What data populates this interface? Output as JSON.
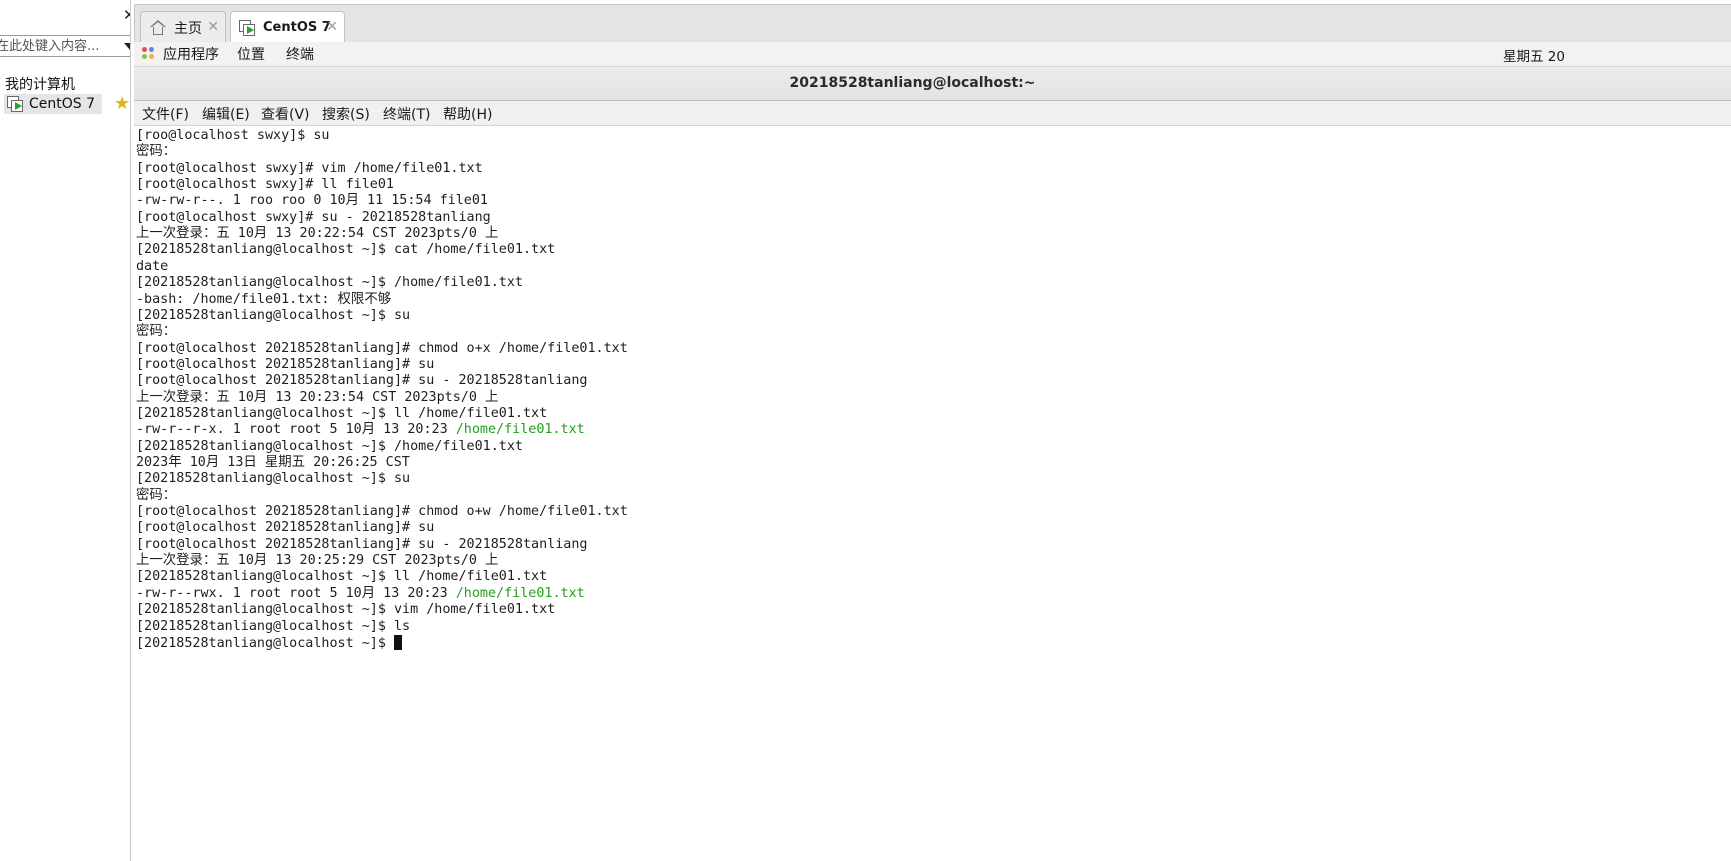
{
  "sidebar": {
    "search_placeholder": "在此处键入内容...",
    "tree_root": "我的计算机",
    "tree_item": "CentOS 7"
  },
  "tabs": [
    {
      "label": "主页",
      "icon": "home-icon"
    },
    {
      "label": "CentOS 7",
      "icon": "vm-icon"
    }
  ],
  "gnome_bar": {
    "applications": "应用程序",
    "places": "位置",
    "terminal": "终端",
    "clock": "星期五 20"
  },
  "window": {
    "title": "20218528tanliang@localhost:~"
  },
  "menubar": [
    "文件(F)",
    "编辑(E)",
    "查看(V)",
    "搜索(S)",
    "终端(T)",
    "帮助(H)"
  ],
  "colors": {
    "accent_green": "#24a11b",
    "star": "#e0b417",
    "vm_play": "#2e9e2e"
  },
  "terminal": {
    "lines": [
      "[roo@localhost swxy]$ su",
      "密码：",
      "[root@localhost swxy]# vim /home/file01.txt",
      "[root@localhost swxy]# ll file01",
      "-rw-rw-r--. 1 roo roo 0 10月 11 15:54 file01",
      "[root@localhost swxy]# su - 20218528tanliang",
      "上一次登录：五 10月 13 20:22:54 CST 2023pts/0 上",
      "[20218528tanliang@localhost ~]$ cat /home/file01.txt",
      "date",
      "[20218528tanliang@localhost ~]$ /home/file01.txt",
      "-bash: /home/file01.txt: 权限不够",
      "[20218528tanliang@localhost ~]$ su",
      "密码：",
      "[root@localhost 20218528tanliang]# chmod o+x /home/file01.txt",
      "[root@localhost 20218528tanliang]# su",
      "[root@localhost 20218528tanliang]# su - 20218528tanliang",
      "上一次登录：五 10月 13 20:23:54 CST 2023pts/0 上",
      "[20218528tanliang@localhost ~]$ ll /home/file01.txt",
      {
        "prefix": "-rw-r--r-x. 1 root root 5 10月 13 20:23 ",
        "green": "/home/file01.txt"
      },
      "[20218528tanliang@localhost ~]$ /home/file01.txt",
      "2023年 10月 13日 星期五 20:26:25 CST",
      "[20218528tanliang@localhost ~]$ su",
      "密码：",
      "[root@localhost 20218528tanliang]# chmod o+w /home/file01.txt",
      "[root@localhost 20218528tanliang]# su",
      "[root@localhost 20218528tanliang]# su - 20218528tanliang",
      "上一次登录：五 10月 13 20:25:29 CST 2023pts/0 上",
      "[20218528tanliang@localhost ~]$ ll /home/file01.txt",
      {
        "prefix": "-rw-r--rwx. 1 root root 5 10月 13 20:23 ",
        "green": "/home/file01.txt"
      },
      "[20218528tanliang@localhost ~]$ vim /home/file01.txt",
      "[20218528tanliang@localhost ~]$ ls",
      {
        "prompt": "[20218528tanliang@localhost ~]$ "
      }
    ]
  }
}
